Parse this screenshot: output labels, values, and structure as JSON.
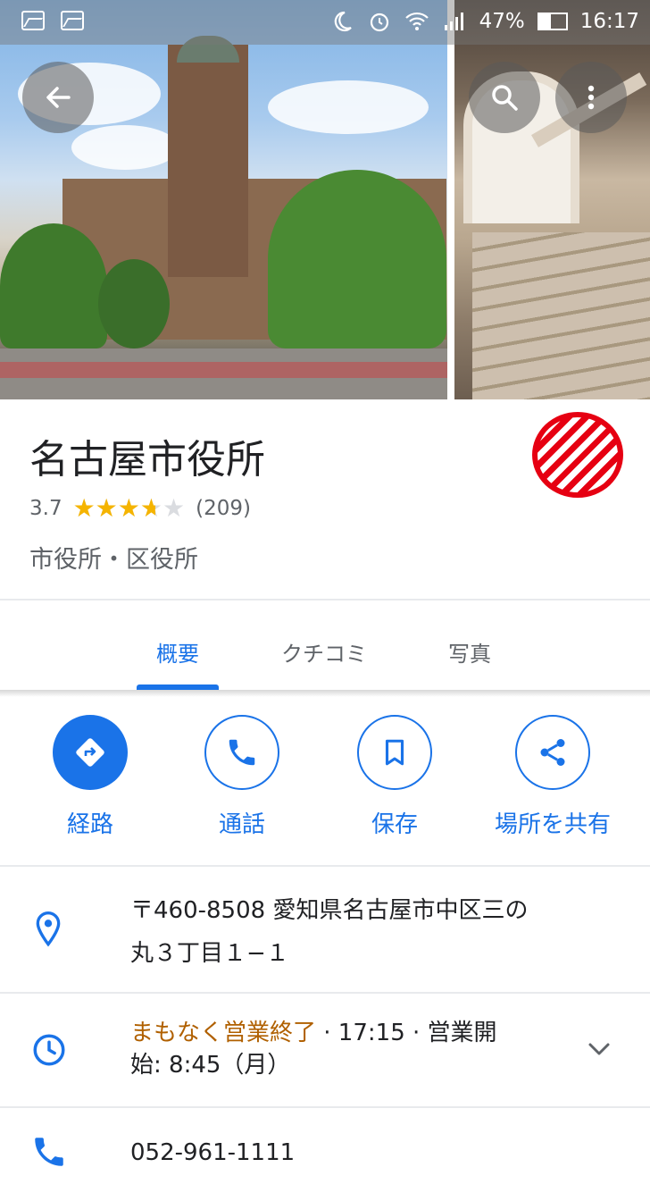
{
  "status_bar": {
    "battery": "47%",
    "time": "16:17"
  },
  "place": {
    "name": "名古屋市役所",
    "rating": "3.7",
    "rating_value": 3.7,
    "review_count": "(209)",
    "category": "市役所・区役所"
  },
  "tabs": [
    {
      "label": "概要",
      "active": true
    },
    {
      "label": "クチコミ",
      "active": false
    },
    {
      "label": "写真",
      "active": false
    }
  ],
  "actions": [
    {
      "label": "経路",
      "icon": "directions-icon"
    },
    {
      "label": "通話",
      "icon": "phone-icon"
    },
    {
      "label": "保存",
      "icon": "bookmark-icon"
    },
    {
      "label": "場所を共有",
      "icon": "share-icon"
    }
  ],
  "address": {
    "line1": "〒460-8508 愛知県名古屋市中区三の",
    "line2": "丸３丁目１−１"
  },
  "hours": {
    "status": "まもなく営業終了",
    "line1_rest": " · 17:15 · 営業開",
    "line2": "始: 8:45（月）"
  },
  "phone": "052-961-1111",
  "colors": {
    "accent": "#1a73e8",
    "star": "#f5b400",
    "closing_soon": "#b06000",
    "badge_red": "#e60012"
  }
}
